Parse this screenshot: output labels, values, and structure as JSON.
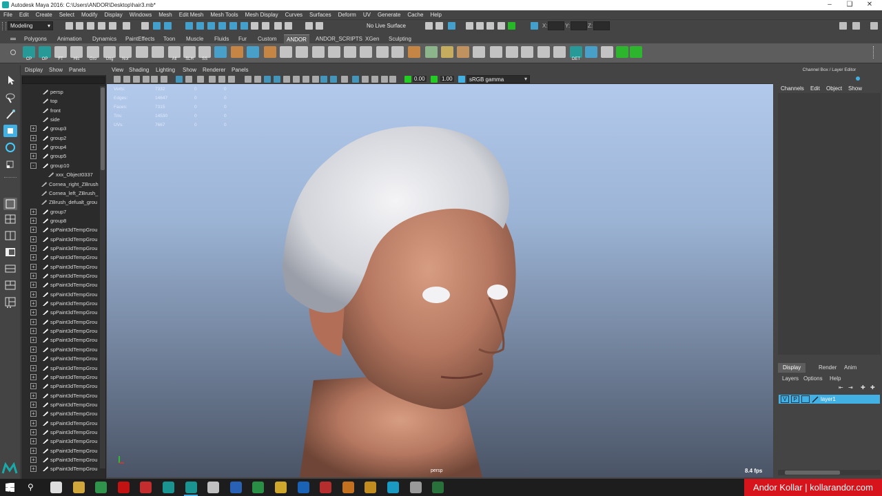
{
  "window": {
    "title": "Autodesk Maya 2016: C:\\Users\\ANDOR\\Desktop\\hair3.mb*"
  },
  "menubar": [
    "File",
    "Edit",
    "Create",
    "Select",
    "Modify",
    "Display",
    "Windows",
    "Mesh",
    "Edit Mesh",
    "Mesh Tools",
    "Mesh Display",
    "Curves",
    "Surfaces",
    "Deform",
    "UV",
    "Generate",
    "Cache",
    "Help"
  ],
  "statusline": {
    "mode": "Modeling",
    "live_surface": "No Live Surface",
    "x_label": "X:",
    "y_label": "Y:",
    "z_label": "Z:"
  },
  "shelf_tabs": [
    "Polygons",
    "Animation",
    "Dynamics",
    "PaintEffects",
    "Toon",
    "Muscle",
    "Fluids",
    "Fur",
    "Custom",
    "ANDOR",
    "ANDOR_SCRIPTS",
    "XGen",
    "Sculpting"
  ],
  "shelf_active_tab": "ANDOR",
  "shelf_labels": [
    "CP",
    "OP",
    "FT",
    "His",
    "Gro",
    "Ung",
    "Nor",
    "All",
    "SLH",
    "SS",
    "DET"
  ],
  "outliner": {
    "menus": [
      "Display",
      "Show",
      "Panels"
    ],
    "items": [
      {
        "label": "persp",
        "type": "camera",
        "indent": 1
      },
      {
        "label": "top",
        "type": "camera",
        "indent": 1
      },
      {
        "label": "front",
        "type": "camera",
        "indent": 1
      },
      {
        "label": "side",
        "type": "camera",
        "indent": 1
      },
      {
        "label": "group3",
        "type": "group",
        "indent": 1,
        "exp": "+"
      },
      {
        "label": "group2",
        "type": "group",
        "indent": 1,
        "exp": "+"
      },
      {
        "label": "group4",
        "type": "group",
        "indent": 1,
        "exp": "+"
      },
      {
        "label": "group5",
        "type": "group",
        "indent": 1,
        "exp": "+"
      },
      {
        "label": "group10",
        "type": "group",
        "indent": 1,
        "exp": "-"
      },
      {
        "label": "xxx_Object0337",
        "type": "mesh",
        "indent": 2
      },
      {
        "label": "Cornea_right_ZBrush",
        "type": "mesh",
        "indent": 2
      },
      {
        "label": "Cornea_left_ZBrush_",
        "type": "mesh",
        "indent": 2
      },
      {
        "label": "ZBrush_defualt_grou",
        "type": "mesh",
        "indent": 2
      },
      {
        "label": "group7",
        "type": "group",
        "indent": 1,
        "exp": "+"
      },
      {
        "label": "group8",
        "type": "group",
        "indent": 1,
        "exp": "+"
      },
      {
        "label": "spPaint3dTempGrou",
        "type": "group",
        "indent": 1,
        "exp": "+"
      },
      {
        "label": "spPaint3dTempGrou",
        "type": "group",
        "indent": 1,
        "exp": "+"
      },
      {
        "label": "spPaint3dTempGrou",
        "type": "group",
        "indent": 1,
        "exp": "+"
      },
      {
        "label": "spPaint3dTempGrou",
        "type": "group",
        "indent": 1,
        "exp": "+"
      },
      {
        "label": "spPaint3dTempGrou",
        "type": "group",
        "indent": 1,
        "exp": "+"
      },
      {
        "label": "spPaint3dTempGrou",
        "type": "group",
        "indent": 1,
        "exp": "+"
      },
      {
        "label": "spPaint3dTempGrou",
        "type": "group",
        "indent": 1,
        "exp": "+"
      },
      {
        "label": "spPaint3dTempGrou",
        "type": "group",
        "indent": 1,
        "exp": "+"
      },
      {
        "label": "spPaint3dTempGrou",
        "type": "group",
        "indent": 1,
        "exp": "+"
      },
      {
        "label": "spPaint3dTempGrou",
        "type": "group",
        "indent": 1,
        "exp": "+"
      },
      {
        "label": "spPaint3dTempGrou",
        "type": "group",
        "indent": 1,
        "exp": "+"
      },
      {
        "label": "spPaint3dTempGrou",
        "type": "group",
        "indent": 1,
        "exp": "+"
      },
      {
        "label": "spPaint3dTempGrou",
        "type": "group",
        "indent": 1,
        "exp": "+"
      },
      {
        "label": "spPaint3dTempGrou",
        "type": "group",
        "indent": 1,
        "exp": "+"
      },
      {
        "label": "spPaint3dTempGrou",
        "type": "group",
        "indent": 1,
        "exp": "+"
      },
      {
        "label": "spPaint3dTempGrou",
        "type": "group",
        "indent": 1,
        "exp": "+"
      },
      {
        "label": "spPaint3dTempGrou",
        "type": "group",
        "indent": 1,
        "exp": "+"
      },
      {
        "label": "spPaint3dTempGrou",
        "type": "group",
        "indent": 1,
        "exp": "+"
      },
      {
        "label": "spPaint3dTempGrou",
        "type": "group",
        "indent": 1,
        "exp": "+"
      },
      {
        "label": "spPaint3dTempGrou",
        "type": "group",
        "indent": 1,
        "exp": "+"
      },
      {
        "label": "spPaint3dTempGrou",
        "type": "group",
        "indent": 1,
        "exp": "+"
      },
      {
        "label": "spPaint3dTempGrou",
        "type": "group",
        "indent": 1,
        "exp": "+"
      },
      {
        "label": "spPaint3dTempGrou",
        "type": "group",
        "indent": 1,
        "exp": "+"
      },
      {
        "label": "spPaint3dTempGrou",
        "type": "group",
        "indent": 1,
        "exp": "+"
      },
      {
        "label": "spPaint3dTempGrou",
        "type": "group",
        "indent": 1,
        "exp": "+"
      },
      {
        "label": "spPaint3dTempGrou",
        "type": "group",
        "indent": 1,
        "exp": "+"
      },
      {
        "label": "spPaint3dTempGrou",
        "type": "group",
        "indent": 1,
        "exp": "+"
      }
    ]
  },
  "viewport": {
    "menus": [
      "View",
      "Shading",
      "Lighting",
      "Show",
      "Renderer",
      "Panels"
    ],
    "exposure": "0.00",
    "gamma": "1.00",
    "color_space": "sRGB gamma",
    "hud_rows": [
      {
        "label": "Verts:",
        "a": "7332",
        "b": "0",
        "c": "0"
      },
      {
        "label": "Edges:",
        "a": "14647",
        "b": "0",
        "c": "0"
      },
      {
        "label": "Faces:",
        "a": "7315",
        "b": "0",
        "c": "0"
      },
      {
        "label": "Tris:",
        "a": "14530",
        "b": "0",
        "c": "0"
      },
      {
        "label": "UVs:",
        "a": "7667",
        "b": "0",
        "c": "0"
      }
    ],
    "camera_label": "persp",
    "fps": "8.4 fps"
  },
  "channel_box": {
    "title": "Channel Box / Layer Editor",
    "menus": [
      "Channels",
      "Edit",
      "Object",
      "Show"
    ]
  },
  "layer_editor": {
    "tabs": [
      "Display",
      "Render",
      "Anim"
    ],
    "active_tab": "Display",
    "menus": [
      "Layers",
      "Options",
      "Help"
    ],
    "layer": {
      "v": "V",
      "p": "P",
      "name": "layer1"
    }
  },
  "watermark": "Andor Kollar | kollarandor.com",
  "colors": {
    "accent": "#43b0e4",
    "active_tab": "#5d5d5d",
    "brand_red": "#d7141b",
    "maya_teal": "#1aa9a6"
  }
}
